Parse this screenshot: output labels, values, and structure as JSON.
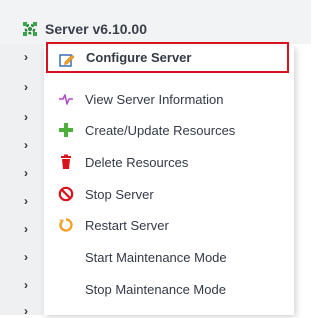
{
  "header": {
    "title": "Server v6.10.00",
    "icon": "server-status-icon"
  },
  "context_menu": {
    "items": [
      {
        "label": "Configure Server",
        "icon": "edit-icon",
        "selected": true
      },
      {
        "label": "View Server Information",
        "icon": "pulse-icon"
      },
      {
        "label": "Create/Update Resources",
        "icon": "plus-icon"
      },
      {
        "label": "Delete Resources",
        "icon": "trash-icon"
      },
      {
        "label": "Stop Server",
        "icon": "stop-icon"
      },
      {
        "label": "Restart Server",
        "icon": "restart-icon"
      },
      {
        "label": "Start Maintenance Mode",
        "icon": ""
      },
      {
        "label": "Stop Maintenance Mode",
        "icon": ""
      }
    ]
  },
  "colors": {
    "highlight_border": "#d9121f",
    "header_bg": "#f2f3f5",
    "gutter_bg": "#eef0f2"
  }
}
